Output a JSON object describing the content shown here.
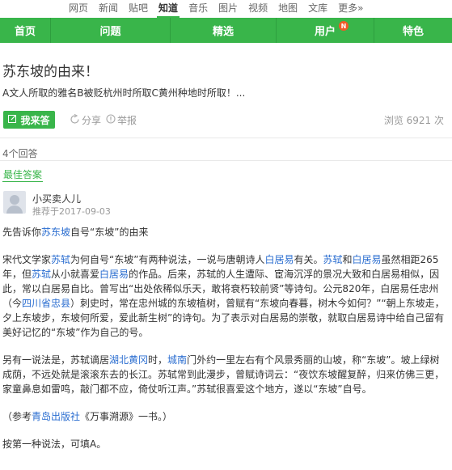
{
  "top_nav": [
    "网页",
    "新闻",
    "贴吧",
    "知道",
    "音乐",
    "图片",
    "视频",
    "地图",
    "文库",
    "更多»"
  ],
  "green_nav": {
    "items": [
      "首页",
      "问题",
      "精选",
      "用户",
      "特色"
    ],
    "user_badge": "N"
  },
  "question": {
    "title": "苏东坡的由来！",
    "description": "A文人所取的雅名B被贬杭州时所取C黄州种地时所取！..."
  },
  "actions": {
    "answer_label": "我来答",
    "share_label": "分享",
    "report_label": "举报",
    "views": "浏览 6921 次"
  },
  "answers": {
    "count": "4个回答",
    "best_label": "最佳答案"
  },
  "answerer": {
    "name": "小买卖人儿",
    "recommend": "推荐于2017-09-03"
  },
  "content": {
    "p1": [
      "先告诉你",
      {
        "kw": "苏东坡"
      },
      "自号“东坡”的由来"
    ],
    "p2": [
      "宋代文学家",
      {
        "kw": "苏轼"
      },
      "为何自号“东坡”有两种说法，一说与唐朝诗人",
      {
        "kw": "白居易"
      },
      "有关。",
      {
        "kw": "苏轼"
      },
      "和",
      {
        "kw": "白居易"
      },
      "虽然相距265年，但",
      {
        "kw": "苏轼"
      },
      "从小就喜爱",
      {
        "kw": "白居易"
      },
      "的作品。后来，苏轼的人生遭际、宦海沉浮的景况大致和白居易相似，因此，常以白居易自比。曾写出“出处依稀似乐天，敢将衰朽较前贤”等诗句。公元820年，白居易任忠州（今",
      {
        "kw": "四川省忠县"
      },
      "）刺史时，常在忠州城的东坡植树，曾赋有“东坡向春暮，树木今如何？”“朝上东坡走，夕上东坡步，东坡何所爱，爱此新生树”的诗句。为了表示对白居易的崇敬，就取白居易诗中给自己留有美好记忆的“东坡”作为自己的号。"
    ],
    "p3": [
      "另有一说法是，苏轼谪居",
      {
        "kw": "湖北黄冈"
      },
      "时，",
      {
        "kw": "城南"
      },
      "门外约一里左右有个风景秀丽的山坡，称“东坡”。坡上绿树成荫，不远处就是滚滚东去的长江。苏轼常到此漫步，曾赋诗词云：“夜饮东坡醒复醉，归来仿佛三更，家童鼻息如雷鸣，敲门都不应，倚仗听江声。”苏轼很喜爱这个地方，遂以“东坡”自号。"
    ],
    "p4": [
      "（参考",
      {
        "kw": "青岛出版社"
      },
      "《万事溯源》一书。）"
    ],
    "p5": [
      "按第一种说法，可填A。"
    ]
  },
  "colors": {
    "brand_green": "#39b54a",
    "keyword_blue": "#2a6dd0",
    "badge_orange": "#f05a28"
  }
}
